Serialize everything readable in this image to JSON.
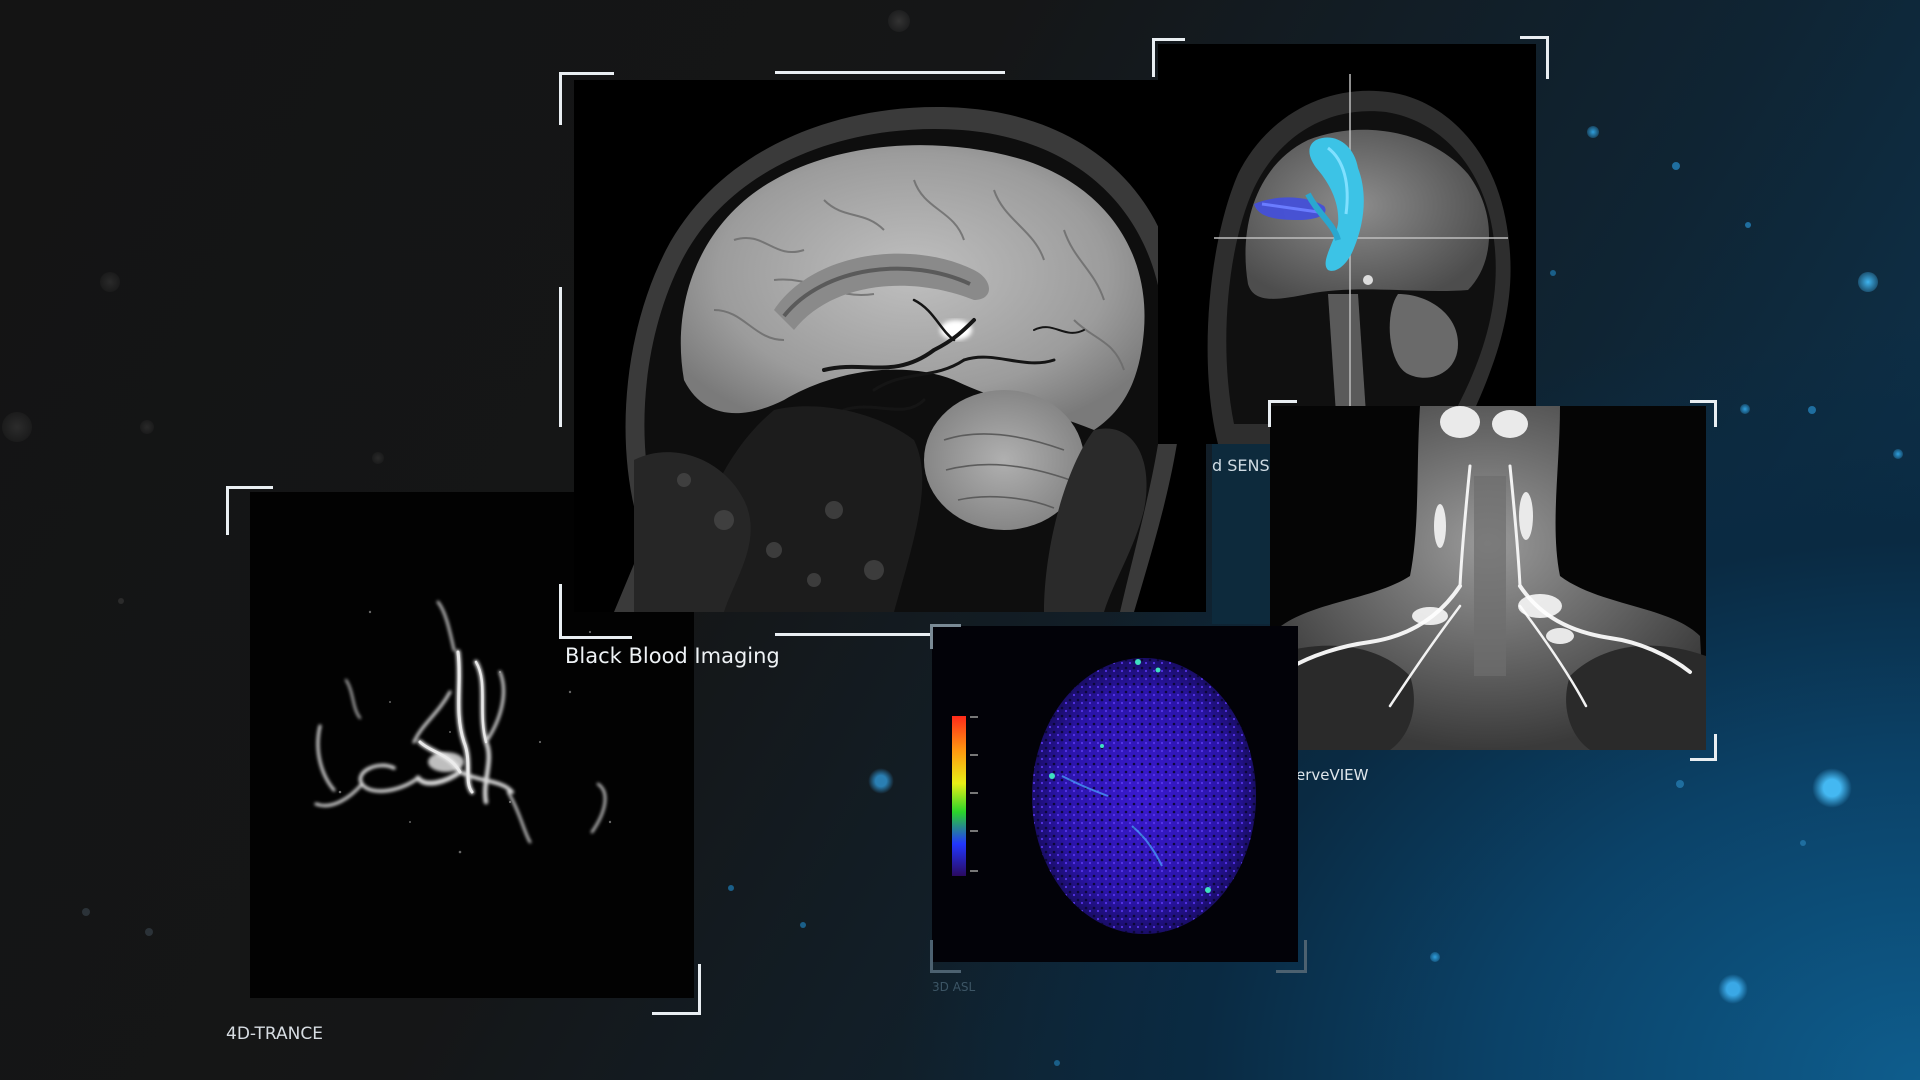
{
  "captions": {
    "black_blood": "Black Blood Imaging",
    "trance": "4D-TRANCE",
    "nerveview": "erveVIEW",
    "sense": "d SENS",
    "asl": "3D ASL"
  },
  "colors": {
    "background_dark": "#141414",
    "background_blue": "#0c5a8a",
    "frame_white": "#e9eef2",
    "tract_cyan": "#3cc3e6",
    "tract_blue": "#4450d8",
    "perfusion_purple": "#3a1fb8"
  },
  "icons": {
    "colorbar": "perfusion-color-scale"
  }
}
